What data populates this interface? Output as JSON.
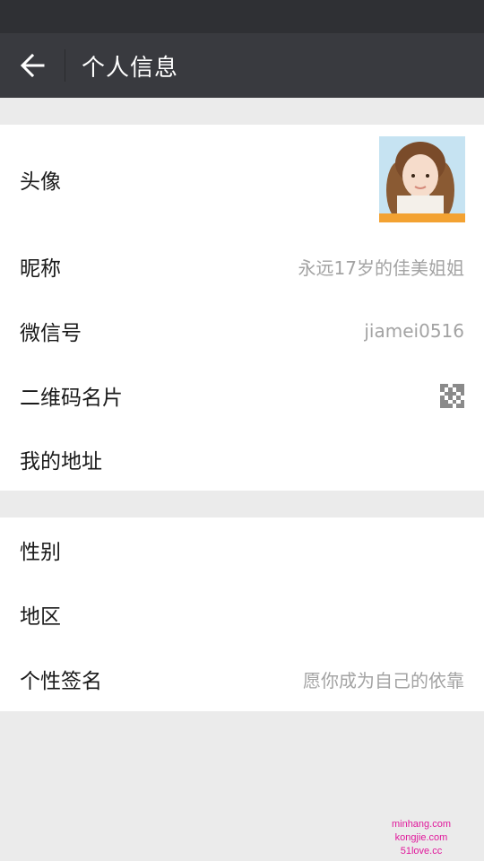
{
  "header": {
    "title": "个人信息"
  },
  "profile": {
    "avatar_label": "头像",
    "nickname_label": "昵称",
    "nickname_value": "永远17岁的佳美姐姐",
    "wechat_id_label": "微信号",
    "wechat_id_value": "jiamei0516",
    "qr_card_label": "二维码名片",
    "address_label": "我的地址"
  },
  "details": {
    "gender_label": "性别",
    "region_label": "地区",
    "signature_label": "个性签名",
    "signature_value": "愿你成为自己的依靠"
  },
  "watermark": {
    "line1": "minhang.com",
    "line2": "kongjie.com",
    "line3": "51love.cc"
  },
  "colors": {
    "title_bar": "#393a3f",
    "status_bar": "#2f3034",
    "background": "#ebebeb",
    "secondary_text": "#a3a3a3",
    "watermark": "#e0189b"
  },
  "icons": {
    "back": "arrow-left-icon",
    "qr": "qr-code-icon"
  }
}
